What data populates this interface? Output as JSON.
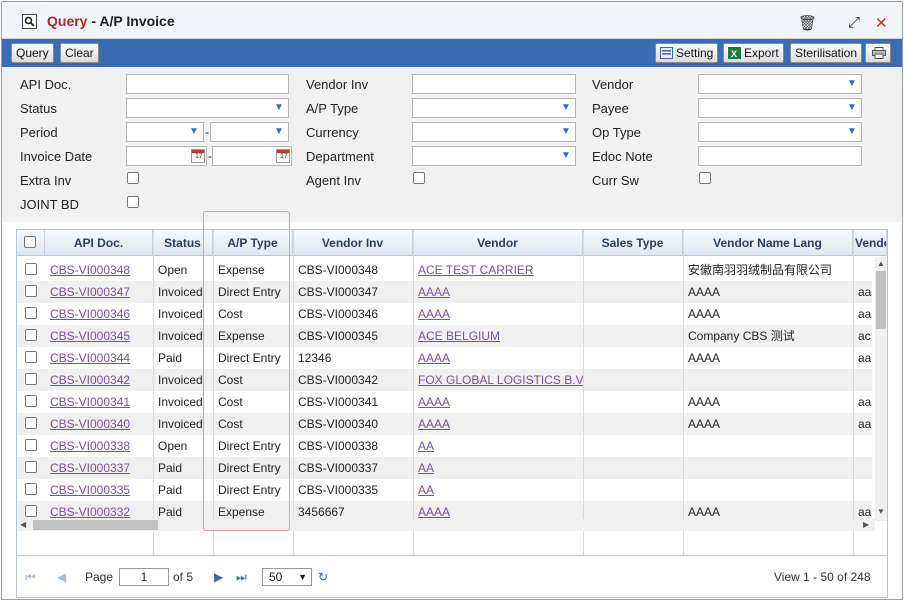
{
  "window": {
    "title_mode": "Query",
    "title_sep": "-",
    "title_name": "A/P Invoice",
    "controls": {
      "delete": "🗑",
      "restore": "⤢",
      "close": "✕"
    }
  },
  "toolbar": {
    "query": "Query",
    "clear": "Clear",
    "setting": "Setting",
    "export": "Export",
    "sterilisation": "Sterilisation"
  },
  "filters": {
    "api_doc": "API Doc.",
    "status": "Status",
    "period": "Period",
    "invoice_date": "Invoice Date",
    "extra_inv": "Extra Inv",
    "joint_bd": "JOINT BD",
    "vendor_inv": "Vendor Inv",
    "ap_type": "A/P Type",
    "currency": "Currency",
    "department": "Department",
    "agent_inv": "Agent Inv",
    "vendor": "Vendor",
    "payee": "Payee",
    "op_type": "Op Type",
    "edoc_note": "Edoc Note",
    "curr_sw": "Curr Sw",
    "dash": "-"
  },
  "grid": {
    "columns": [
      "API Doc.",
      "Status",
      "A/P Type",
      "Vendor Inv",
      "Vendor",
      "Sales Type",
      "Vendor Name Lang",
      "Vendo"
    ],
    "rows": [
      {
        "api": "CBS-VI000348",
        "status": "Open",
        "type": "Expense",
        "vinv": "CBS-VI000348",
        "vendor": "ACE TEST CARRIER",
        "sales": "",
        "lang": "安徽南羽羽绒制品有限公司",
        "v2": ""
      },
      {
        "api": "CBS-VI000347",
        "status": "Invoiced",
        "type": "Direct Entry",
        "vinv": "CBS-VI000347",
        "vendor": "AAAA",
        "sales": "",
        "lang": "AAAA",
        "v2": "aa"
      },
      {
        "api": "CBS-VI000346",
        "status": "Invoiced",
        "type": "Cost",
        "vinv": "CBS-VI000346",
        "vendor": "AAAA",
        "sales": "",
        "lang": "AAAA",
        "v2": "aa"
      },
      {
        "api": "CBS-VI000345",
        "status": "Invoiced",
        "type": "Expense",
        "vinv": "CBS-VI000345",
        "vendor": "ACE BELGIUM",
        "sales": "",
        "lang": "Company CBS 测试",
        "v2": "ac"
      },
      {
        "api": "CBS-VI000344",
        "status": "Paid",
        "type": "Direct Entry",
        "vinv": "12346",
        "vendor": "AAAA",
        "sales": "",
        "lang": "AAAA",
        "v2": "aa"
      },
      {
        "api": "CBS-VI000342",
        "status": "Invoiced",
        "type": "Cost",
        "vinv": "CBS-VI000342",
        "vendor": "FOX GLOBAL LOGISTICS B.V",
        "sales": "",
        "lang": "",
        "v2": ""
      },
      {
        "api": "CBS-VI000341",
        "status": "Invoiced",
        "type": "Cost",
        "vinv": "CBS-VI000341",
        "vendor": "AAAA",
        "sales": "",
        "lang": "AAAA",
        "v2": "aa"
      },
      {
        "api": "CBS-VI000340",
        "status": "Invoiced",
        "type": "Cost",
        "vinv": "CBS-VI000340",
        "vendor": "AAAA",
        "sales": "",
        "lang": "AAAA",
        "v2": "aa"
      },
      {
        "api": "CBS-VI000338",
        "status": "Open",
        "type": "Direct Entry",
        "vinv": "CBS-VI000338",
        "vendor": "AA",
        "sales": "",
        "lang": "",
        "v2": ""
      },
      {
        "api": "CBS-VI000337",
        "status": "Paid",
        "type": "Direct Entry",
        "vinv": "CBS-VI000337",
        "vendor": "AA",
        "sales": "",
        "lang": "",
        "v2": ""
      },
      {
        "api": "CBS-VI000335",
        "status": "Paid",
        "type": "Direct Entry",
        "vinv": "CBS-VI000335",
        "vendor": "AA",
        "sales": "",
        "lang": "",
        "v2": ""
      },
      {
        "api": "CBS-VI000332",
        "status": "Paid",
        "type": "Expense",
        "vinv": "3456667",
        "vendor": "AAAA",
        "sales": "",
        "lang": "AAAA",
        "v2": "aa"
      }
    ]
  },
  "pager": {
    "page_label": "Page",
    "page_value": "1",
    "of_label": "of 5",
    "page_size": "50",
    "summary": "View 1 - 50 of 248"
  },
  "colors": {
    "accent": "#3b6bb3",
    "link": "#7b4fa3",
    "title_red": "#b22222"
  }
}
